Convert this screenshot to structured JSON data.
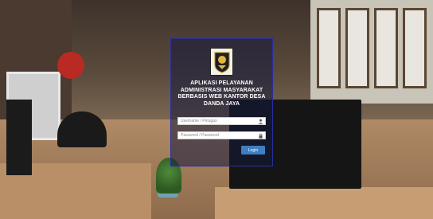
{
  "app": {
    "title": "APLIKASI PELAYANAN ADMINISTRASI MASYARAKAT BERBASIS WEB KANTOR DESA DANDA JAYA"
  },
  "login": {
    "username_placeholder": "Username / Petugas",
    "username_value": "",
    "username_icon": "user-icon",
    "password_placeholder": "Password / Password",
    "password_value": "",
    "password_icon": "lock-icon",
    "button_label": "Login"
  },
  "colors": {
    "panel_border": "#2a2f9a",
    "button": "#3d7fc4"
  }
}
